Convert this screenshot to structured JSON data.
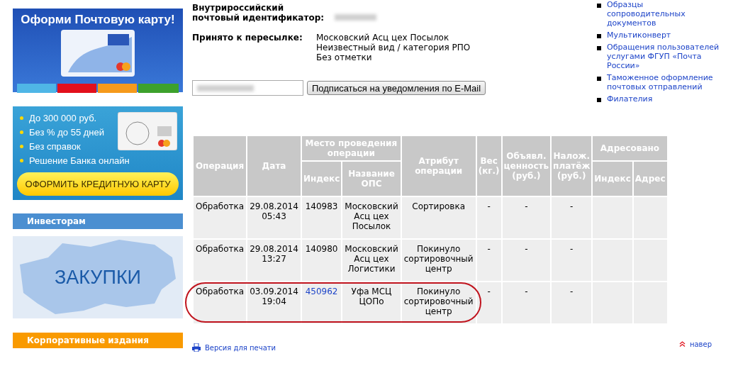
{
  "sidebar": {
    "postal_banner": {
      "title": "Оформи Почтовую карту!"
    },
    "credit_banner": {
      "bullets": [
        "До 300 000 руб.",
        "Без % до 55 дней",
        "Без справок",
        "Решение Банка онлайн"
      ],
      "button": "ОФОРМИТЬ КРЕДИТНУЮ КАРТУ"
    },
    "investors": "Инвесторам",
    "purchases": {
      "label": "ЗАКУПКИ"
    },
    "corporate": "Корпоративные издания"
  },
  "tracking": {
    "id_label": "Внутрироссийский почтовый идентификатор:",
    "accepted_label": "Принято к пересылке:",
    "accepted_lines": [
      "Московский Асц цех Посылок",
      "Неизвестный вид / категория РПО",
      "Без отметки"
    ],
    "subscribe_button": "Подписаться на уведомления по E-Mail"
  },
  "links": [
    "Образцы сопроводительных документов",
    "Мультиконверт",
    "Обращения пользователей услугами ФГУП «Почта России»",
    "Таможенное оформление почтовых отправлений",
    "Филателия"
  ],
  "table": {
    "headers": {
      "operation": "Операция",
      "date": "Дата",
      "place": "Место проведения операции",
      "index": "Индекс",
      "office": "Название ОПС",
      "attribute": "Атрибут операции",
      "weight": "Вес (кг.)",
      "declared": "Объявл. ценность (руб.)",
      "cod": "Налож. платёж (руб.)",
      "addressed": "Адресовано",
      "addr_index": "Индекс",
      "address": "Адрес"
    },
    "rows": [
      {
        "cells": [
          "Обработка",
          "29.08.2014 05:43",
          "140983",
          "Московский Асц цех Посылок",
          "Сортировка",
          "-",
          "-",
          "-"
        ],
        "index_link": false,
        "highlighted": false
      },
      {
        "cells": [
          "Обработка",
          "29.08.2014 13:27",
          "140980",
          "Московский Асц цех Логистики",
          "Покинуло сортировочный центр",
          "-",
          "-",
          "-"
        ],
        "index_link": false,
        "highlighted": false
      },
      {
        "cells": [
          "Обработка",
          "03.09.2014 19:04",
          "450962",
          "Уфа МСЦ ЦОПо",
          "Покинуло сортировочный центр",
          "-",
          "-",
          "-"
        ],
        "index_link": true,
        "highlighted": true
      }
    ]
  },
  "print_link": "Версия для печати",
  "top_link": "навер"
}
